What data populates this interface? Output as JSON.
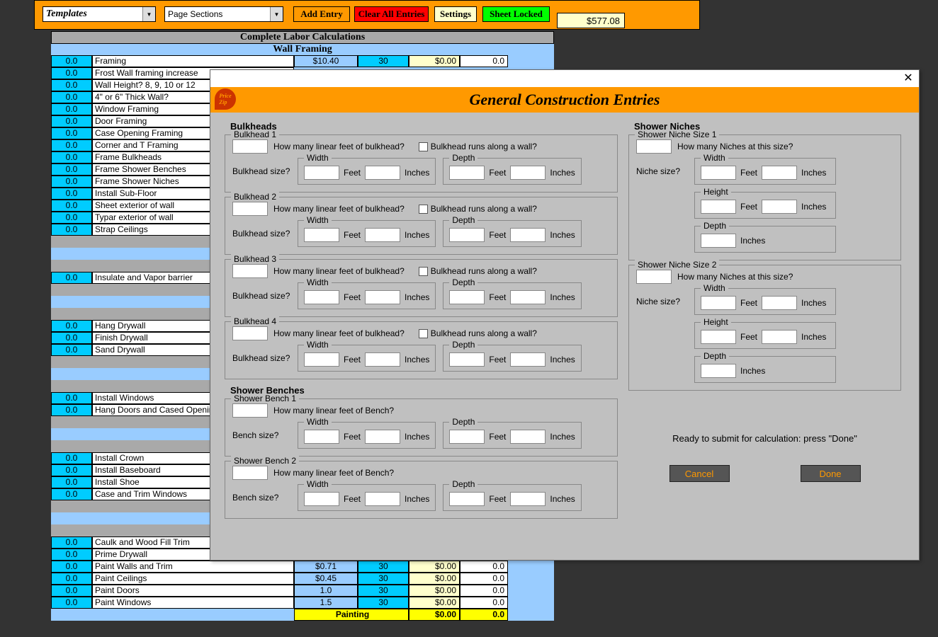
{
  "toolbar": {
    "templates": "Templates",
    "page_sections": "Page Sections",
    "add_entry": "Add Entry",
    "clear_all": "Clear All Entries",
    "settings": "Settings",
    "sheet_locked": "Sheet Locked",
    "amount": "$577.08"
  },
  "sheet": {
    "title": "Complete Labor Calculations",
    "section": "Wall Framing",
    "rows": [
      {
        "n": "0.0",
        "d": "Framing",
        "a": "$10.40",
        "b": "30",
        "c": "$0.00",
        "e": "0.0"
      },
      {
        "n": "0.0",
        "d": "Frost Wall framing increase"
      },
      {
        "n": "0.0",
        "d": "Wall Height? 8, 9, 10 or 12"
      },
      {
        "n": "0.0",
        "d": "4\" or 6\" Thick Wall?"
      },
      {
        "n": "0.0",
        "d": "Window Framing"
      },
      {
        "n": "0.0",
        "d": "Door Framing"
      },
      {
        "n": "0.0",
        "d": "Case Opening Framing"
      },
      {
        "n": "0.0",
        "d": "Corner and T Framing"
      },
      {
        "n": "0.0",
        "d": "Frame Bulkheads"
      },
      {
        "n": "0.0",
        "d": "Frame Shower Benches"
      },
      {
        "n": "0.0",
        "d": "Frame Shower Niches"
      },
      {
        "n": "0.0",
        "d": "Install Sub-Floor"
      },
      {
        "n": "0.0",
        "d": "Sheet exterior of wall"
      },
      {
        "n": "0.0",
        "d": "Typar exterior of wall"
      },
      {
        "n": "0.0",
        "d": "Strap Ceilings"
      }
    ],
    "insulate": {
      "n": "0.0",
      "d": "Insulate and Vapor barrier"
    },
    "drywall": [
      {
        "n": "0.0",
        "d": "Hang Drywall"
      },
      {
        "n": "0.0",
        "d": "Finish Drywall"
      },
      {
        "n": "0.0",
        "d": "Sand Drywall"
      }
    ],
    "windows": [
      {
        "n": "0.0",
        "d": "Install Windows"
      },
      {
        "n": "0.0",
        "d": "Hang Doors and Cased Openings"
      }
    ],
    "trim": [
      {
        "n": "0.0",
        "d": "Install Crown"
      },
      {
        "n": "0.0",
        "d": "Install Baseboard"
      },
      {
        "n": "0.0",
        "d": "Install Shoe"
      },
      {
        "n": "0.0",
        "d": "Case and Trim Windows"
      }
    ],
    "paint": [
      {
        "n": "0.0",
        "d": "Caulk and Wood Fill Trim"
      },
      {
        "n": "0.0",
        "d": "Prime Drywall"
      },
      {
        "n": "0.0",
        "d": "Paint Walls and Trim",
        "a": "$0.71",
        "b": "30",
        "c": "$0.00",
        "e": "0.0"
      },
      {
        "n": "0.0",
        "d": "Paint Ceilings",
        "a": "$0.45",
        "b": "30",
        "c": "$0.00",
        "e": "0.0"
      },
      {
        "n": "0.0",
        "d": "Paint Doors",
        "a": "1.0",
        "b": "30",
        "c": "$0.00",
        "e": "0.0"
      },
      {
        "n": "0.0",
        "d": "Paint Windows",
        "a": "1.5",
        "b": "30",
        "c": "$0.00",
        "e": "0.0"
      }
    ],
    "paint_footer": {
      "d": "Painting",
      "c": "$0.00",
      "e": "0.0"
    }
  },
  "dialog": {
    "title": "General Construction Entries",
    "bulkheads_title": "Bulkheads",
    "bulkhead_labels": [
      "Bulkhead 1",
      "Bulkhead 2",
      "Bulkhead 3",
      "Bulkhead 4"
    ],
    "linear_feet_q": "How many linear feet of bulkhead?",
    "runs_along": "Bulkhead runs along a wall?",
    "size_label": "Bulkhead size?",
    "width": "Width",
    "depth": "Depth",
    "height": "Height",
    "feet": "Feet",
    "inches": "Inches",
    "benches_title": "Shower Benches",
    "bench_labels": [
      "Shower Bench 1",
      "Shower Bench 2"
    ],
    "bench_feet_q": "How many linear feet of Bench?",
    "bench_size": "Bench size?",
    "niches_title": "Shower Niches",
    "niche_labels": [
      "Shower Niche Size 1",
      "Shower Niche Size 2"
    ],
    "niche_q": "How many Niches at this size?",
    "niche_size": "Niche size?",
    "submit_text": "Ready to submit for calculation: press \"Done\"",
    "cancel": "Cancel",
    "done": "Done"
  }
}
